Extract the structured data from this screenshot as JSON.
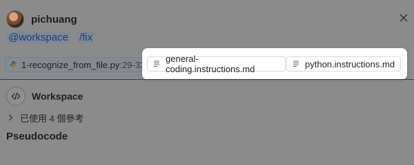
{
  "header": {
    "username": "pichuang",
    "avatar_icon": "user-avatar",
    "close_icon": "close-icon"
  },
  "command": {
    "workspace_token": "@workspace",
    "fix_token": "/fix"
  },
  "references": {
    "file_chip": {
      "filename": "1-recognize_from_file.py",
      "line_range": ":29-33",
      "icon": "python-file-icon"
    },
    "instructions": [
      {
        "label": "general-coding.instructions.md",
        "icon": "document-icon"
      },
      {
        "label": "python.instructions.md",
        "icon": "document-icon"
      }
    ]
  },
  "workspace": {
    "title": "Workspace",
    "icon": "code-icon",
    "refs_used": "已使用 4 個參考"
  },
  "section_title": "Pseudocode",
  "colors": {
    "dim_background": "#8b8b8b",
    "card_background": "#ffffff",
    "token_color": "#1d3f78",
    "divider": "#1f3f7a"
  }
}
